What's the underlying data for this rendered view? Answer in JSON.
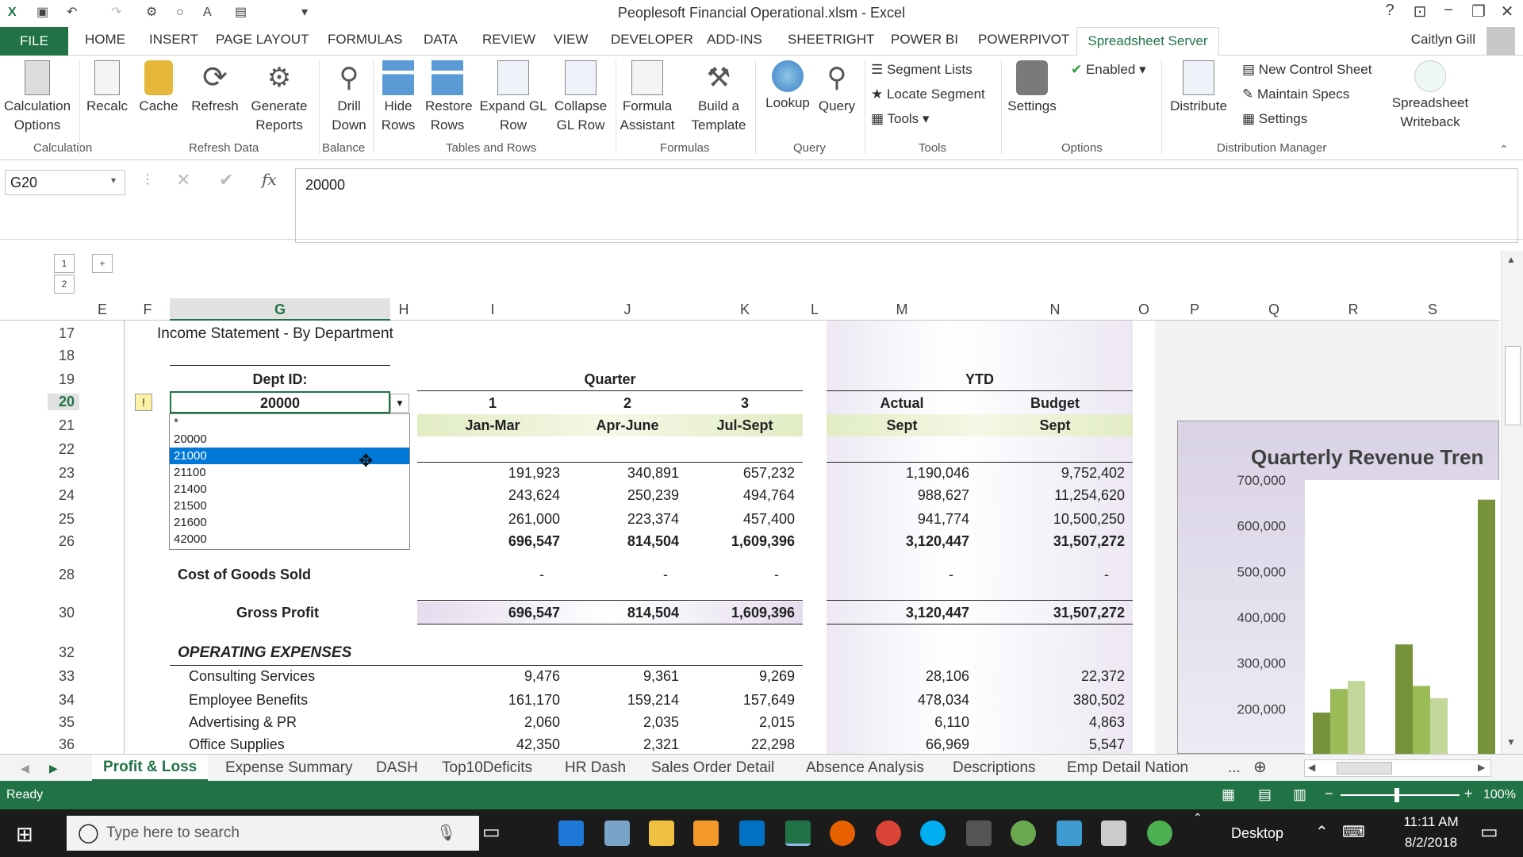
{
  "window": {
    "title": "Peoplesoft Financial Operational.xlsm - Excel",
    "user": "Caitlyn Gill"
  },
  "tabs": {
    "file": "FILE",
    "items": [
      "HOME",
      "INSERT",
      "PAGE LAYOUT",
      "FORMULAS",
      "DATA",
      "REVIEW",
      "VIEW",
      "DEVELOPER",
      "ADD-INS",
      "SHEETRIGHT",
      "POWER BI",
      "POWERPIVOT"
    ],
    "active": "Spreadsheet Server"
  },
  "ribbon": {
    "calc_options": "Calculation Options",
    "recalc": "Recalc",
    "cache": "Cache",
    "refresh": "Refresh",
    "generate_reports": "Generate Reports",
    "drill_down": "Drill Down",
    "hide_rows": "Hide Rows",
    "restore_rows": "Restore Rows",
    "expand_gl": "Expand GL Row",
    "collapse_gl": "Collapse GL Row",
    "formula_assistant": "Formula Assistant",
    "build_template": "Build a Template",
    "lookup": "Lookup",
    "query": "Query",
    "segment_lists": "Segment Lists",
    "locate_segment": "Locate Segment",
    "tools": "Tools",
    "settings_opt": "Settings",
    "enabled": "Enabled",
    "distribute": "Distribute",
    "new_control_sheet": "New Control Sheet",
    "maintain_specs": "Maintain Specs",
    "settings_dist": "Settings",
    "writeback": "Spreadsheet Writeback",
    "groups": {
      "calculation": "Calculation",
      "refresh_data": "Refresh Data",
      "balance": "Balance",
      "tables_rows": "Tables and Rows",
      "formulas": "Formulas",
      "query": "Query",
      "tools": "Tools",
      "options": "Options",
      "distribution": "Distribution Manager"
    }
  },
  "formula_bar": {
    "name_box": "G20",
    "value": "20000"
  },
  "outline": {
    "levels_top": [
      "1",
      "2"
    ],
    "levels_left": [
      "1",
      "2"
    ],
    "expand": "+"
  },
  "columns": [
    "E",
    "F",
    "G",
    "H",
    "I",
    "J",
    "K",
    "L",
    "M",
    "N",
    "O",
    "P",
    "Q",
    "R",
    "S"
  ],
  "rows": [
    "17",
    "18",
    "19",
    "20",
    "21",
    "22",
    "23",
    "24",
    "25",
    "26",
    "28",
    "30",
    "32",
    "33",
    "34",
    "35",
    "36"
  ],
  "sheet": {
    "title": "Income Statement - By Department",
    "dept_label": "Dept ID:",
    "dept_value": "20000",
    "quarter": "Quarter",
    "ytd": "YTD",
    "q_nums": [
      "1",
      "2",
      "3"
    ],
    "q_periods": [
      "Jan-Mar",
      "Apr-June",
      "Jul-Sept"
    ],
    "ytd_hdr": [
      "Actual",
      "Budget"
    ],
    "ytd_period": [
      "Sept",
      "Sept"
    ],
    "rev_rows": [
      [
        "191,923",
        "340,891",
        "657,232",
        "1,190,046",
        "9,752,402"
      ],
      [
        "243,624",
        "250,239",
        "494,764",
        "988,627",
        "11,254,620"
      ],
      [
        "261,000",
        "223,374",
        "457,400",
        "941,774",
        "10,500,250"
      ],
      [
        "696,547",
        "814,504",
        "1,609,396",
        "3,120,447",
        "31,507,272"
      ]
    ],
    "cogs_label": "Cost of Goods Sold",
    "dash": "-",
    "gross_label": "Gross Profit",
    "gross": [
      "696,547",
      "814,504",
      "1,609,396",
      "3,120,447",
      "31,507,272"
    ],
    "opex_label": "OPERATING EXPENSES",
    "opex": [
      {
        "label": "Consulting Services",
        "v": [
          "9,476",
          "9,361",
          "9,269",
          "28,106",
          "22,372"
        ]
      },
      {
        "label": "Employee Benefits",
        "v": [
          "161,170",
          "159,214",
          "157,649",
          "478,034",
          "380,502"
        ]
      },
      {
        "label": "Advertising & PR",
        "v": [
          "2,060",
          "2,035",
          "2,015",
          "6,110",
          "4,863"
        ]
      },
      {
        "label": "Office Supplies",
        "v": [
          "42,350",
          "2,321",
          "22,298",
          "66,969",
          "5,547"
        ]
      }
    ]
  },
  "dropdown": {
    "options": [
      "*",
      "20000",
      "21000",
      "21100",
      "21400",
      "21500",
      "21600",
      "42000"
    ],
    "selected": "21000"
  },
  "chart_data": {
    "type": "bar",
    "title": "Quarterly Revenue Tren",
    "y_ticks": [
      "700,000",
      "600,000",
      "500,000",
      "400,000",
      "300,000",
      "200,000"
    ],
    "ylim": [
      100000,
      700000
    ],
    "groups": [
      {
        "values": [
          191923,
          243624,
          261000
        ]
      },
      {
        "values": [
          340891,
          250239,
          223374
        ]
      },
      {
        "values": [
          657232
        ]
      }
    ],
    "colors": [
      "#76933c",
      "#9bbb59",
      "#c4d79b"
    ]
  },
  "sheet_tabs": {
    "items": [
      "Profit & Loss",
      "Expense Summary",
      "DASH",
      "Top10Deficits",
      "HR Dash",
      "Sales Order Detail",
      "Absence Analysis",
      "Descriptions",
      "Emp Detail Nation"
    ],
    "more": "..."
  },
  "status": {
    "text": "Ready",
    "zoom": "100%"
  },
  "taskbar": {
    "search": "Type here to search",
    "desktop": "Desktop",
    "time": "11:11 AM",
    "date": "8/2/2018"
  }
}
